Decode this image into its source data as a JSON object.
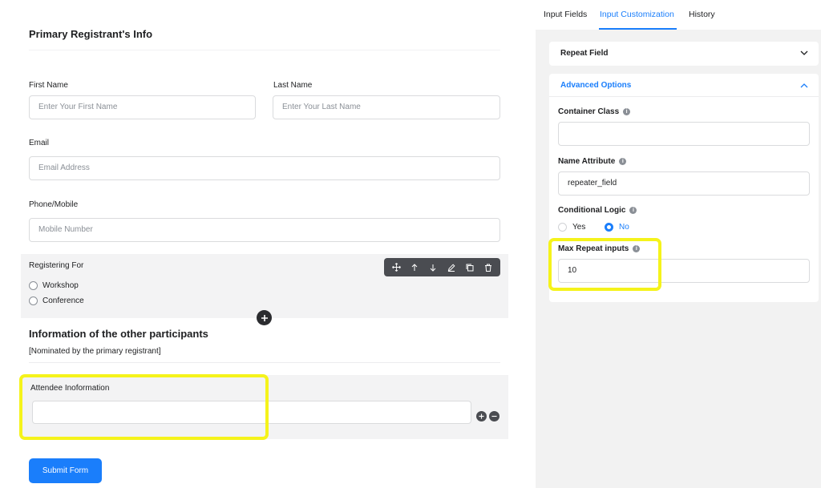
{
  "form": {
    "title": "Primary Registrant's Info",
    "first_name": {
      "label": "First Name",
      "placeholder": "Enter Your First Name"
    },
    "last_name": {
      "label": "Last Name",
      "placeholder": "Enter Your Last Name"
    },
    "email": {
      "label": "Email",
      "placeholder": "Email Address"
    },
    "phone": {
      "label": "Phone/Mobile",
      "placeholder": "Mobile Number"
    },
    "registering_for": {
      "label": "Registering For",
      "options": [
        "Workshop",
        "Conference"
      ]
    },
    "section_title": "Information of the other participants",
    "section_subtitle": "[Nominated by the primary registrant]",
    "attendee": {
      "label": "Attendee Inoformation",
      "value": ""
    },
    "submit_label": "Submit Form"
  },
  "panel": {
    "tabs": [
      {
        "label": "Input Fields",
        "active": false
      },
      {
        "label": "Input Customization",
        "active": true
      },
      {
        "label": "History",
        "active": false
      }
    ],
    "repeat_field_label": "Repeat Field",
    "advanced_options_label": "Advanced Options",
    "container_class": {
      "label": "Container Class",
      "value": ""
    },
    "name_attribute": {
      "label": "Name Attribute",
      "value": "repeater_field"
    },
    "conditional_logic": {
      "label": "Conditional Logic",
      "options": [
        "Yes",
        "No"
      ],
      "selected": "No"
    },
    "max_repeat": {
      "label": "Max Repeat inputs",
      "value": "10"
    }
  },
  "colors": {
    "accent": "#1a7efb",
    "highlight": "#f5f31b",
    "toolbar": "#4a4c51"
  },
  "icons": [
    "move-icon",
    "arrow-up-icon",
    "arrow-down-icon",
    "edit-icon",
    "copy-icon",
    "trash-icon",
    "plus-circle-icon",
    "minus-circle-icon",
    "chevron-down-icon",
    "chevron-up-icon",
    "info-icon"
  ]
}
